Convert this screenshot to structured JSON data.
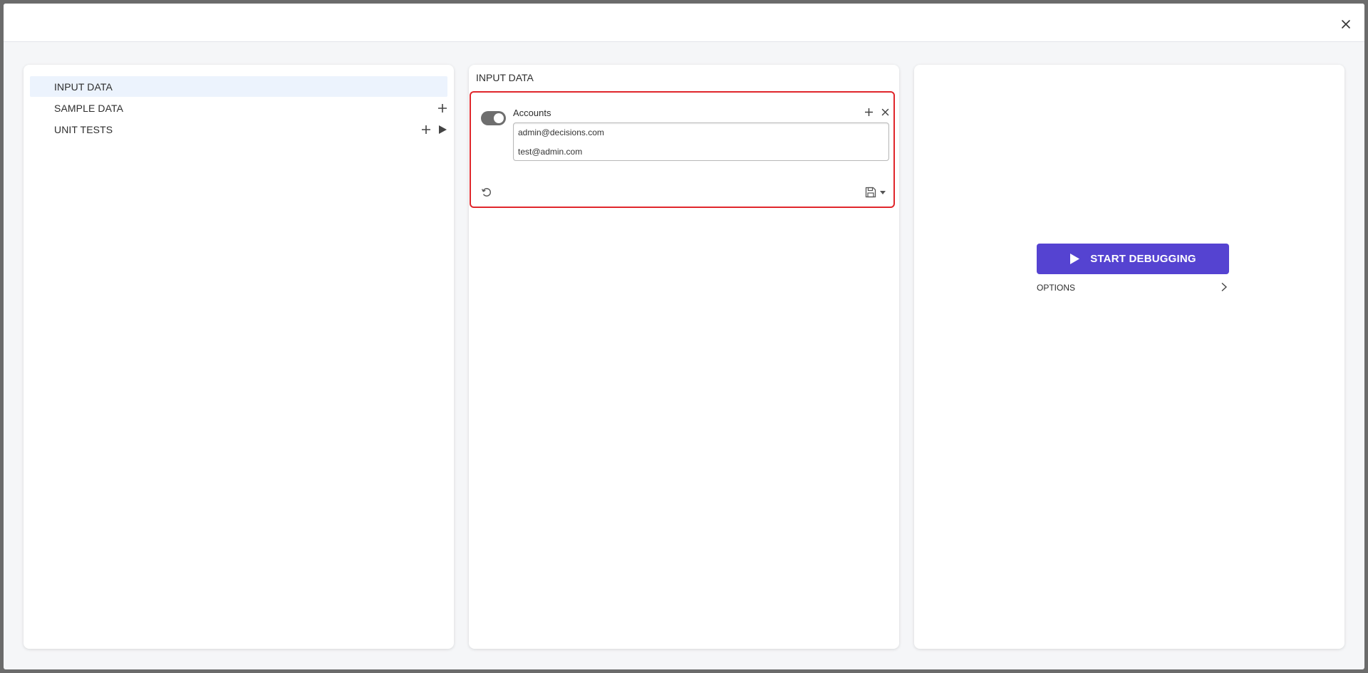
{
  "nav": {
    "items": [
      {
        "label": "INPUT DATA"
      },
      {
        "label": "SAMPLE DATA"
      },
      {
        "label": "UNIT TESTS"
      }
    ]
  },
  "input_data": {
    "title": "INPUT DATA",
    "parameter": {
      "name": "Accounts",
      "enabled": true,
      "values": [
        "admin@decisions.com",
        "test@admin.com"
      ]
    }
  },
  "debug": {
    "start_label": "START DEBUGGING",
    "options_label": "OPTIONS"
  },
  "colors": {
    "accent": "#5543d1",
    "highlight_border": "#e0262b",
    "active_nav_bg": "#ecf3fd"
  },
  "icons": [
    "close-icon",
    "plus-icon",
    "play-icon",
    "reset-icon",
    "save-icon",
    "caret-down-icon",
    "chevron-right-icon"
  ]
}
